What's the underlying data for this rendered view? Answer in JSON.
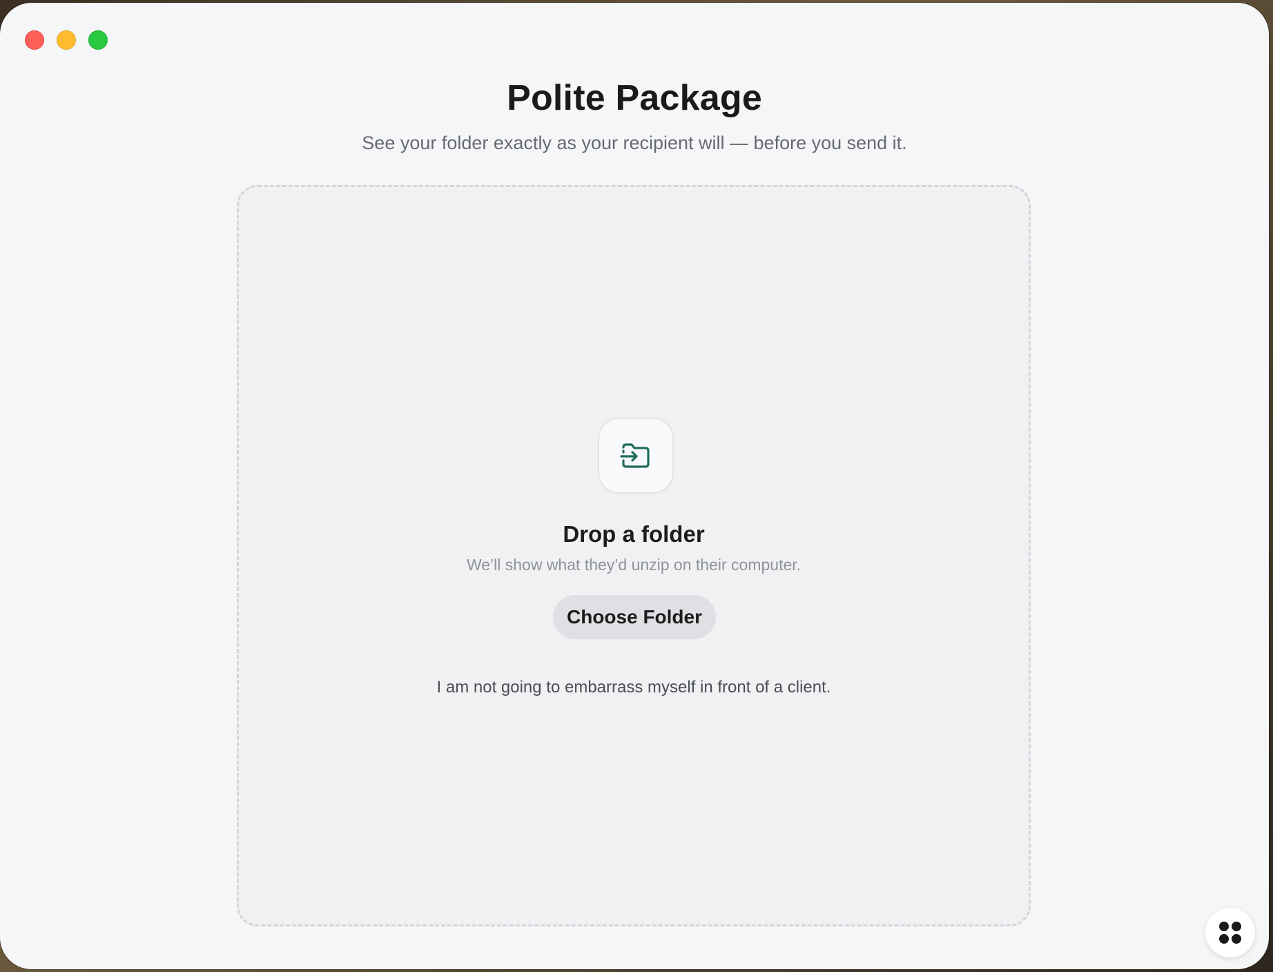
{
  "window": {
    "traffic_lights": [
      "close",
      "minimize",
      "zoom"
    ]
  },
  "header": {
    "title": "Polite Package",
    "subtitle": "See your folder exactly as your recipient will — before you send it."
  },
  "dropzone": {
    "icon": "folder-import-icon",
    "title": "Drop a folder",
    "hint": "We’ll show what they’d unzip on their computer.",
    "button_label": "Choose Folder",
    "tagline": "I am not going to embarrass myself in front of a client."
  },
  "corner_button": {
    "icon": "link-icon"
  },
  "colors": {
    "accent": "#1f6b5c",
    "close": "#fe5f57",
    "minimize": "#febc2e",
    "zoom": "#28c840"
  }
}
